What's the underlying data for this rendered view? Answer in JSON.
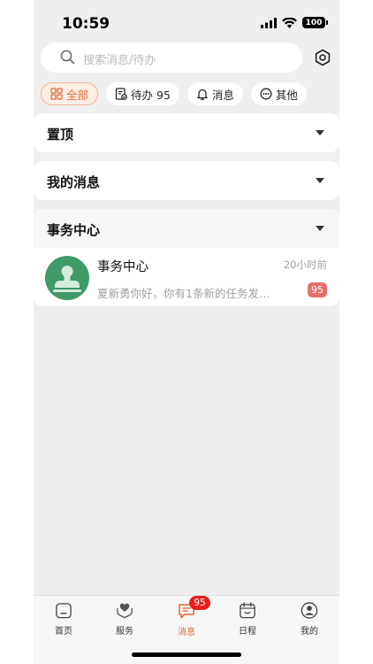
{
  "status": {
    "time": "10:59",
    "battery": "100"
  },
  "search": {
    "placeholder": "搜索消息/待办"
  },
  "chips": [
    {
      "label": "全部",
      "icon": "grid-icon",
      "active": true
    },
    {
      "label": "待办 95",
      "icon": "todo-icon",
      "active": false
    },
    {
      "label": "消息",
      "icon": "bell-icon",
      "active": false
    },
    {
      "label": "其他",
      "icon": "more-icon",
      "active": false
    }
  ],
  "sections": [
    {
      "title": "置顶"
    },
    {
      "title": "我的消息"
    }
  ],
  "group": {
    "title": "事务中心",
    "items": [
      {
        "title": "事务中心",
        "time": "20小时前",
        "preview": "夏新勇你好，你有1条新的任务发…",
        "badge": "95"
      }
    ]
  },
  "tabbar": {
    "items": [
      {
        "label": "首页",
        "icon": "home-icon"
      },
      {
        "label": "服务",
        "icon": "service-heart-icon"
      },
      {
        "label": "消息",
        "icon": "message-icon",
        "badge": "95",
        "active": true
      },
      {
        "label": "日程",
        "icon": "calendar-icon"
      },
      {
        "label": "我的",
        "icon": "profile-icon"
      }
    ]
  },
  "colors": {
    "accent": "#e06a35",
    "badge_red": "#e8201c",
    "avatar_green": "#3f9a68"
  }
}
